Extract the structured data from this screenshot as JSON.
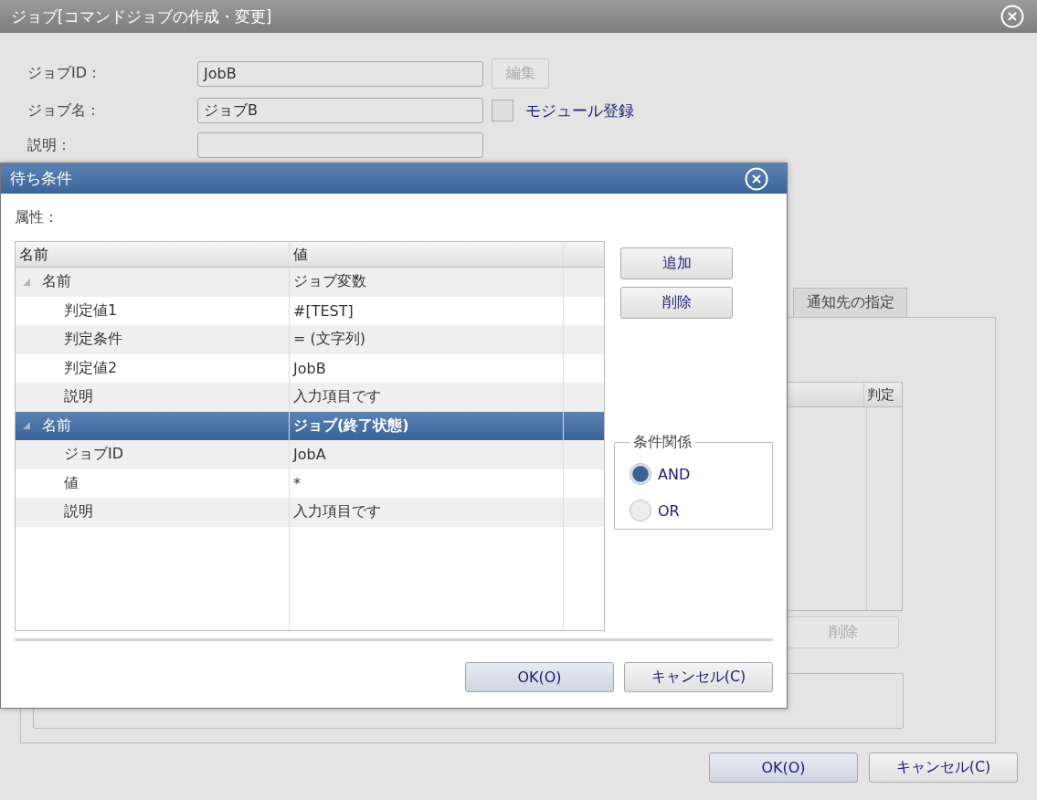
{
  "window": {
    "title": "ジョブ[コマンドジョブの作成・変更]"
  },
  "form": {
    "job_id": {
      "label": "ジョブID：",
      "value": "JobB"
    },
    "edit_button": {
      "label": "編集",
      "disabled": true
    },
    "job_name": {
      "label": "ジョブ名：",
      "value": "ジョブB"
    },
    "module": {
      "label": "モジュール登録",
      "checked": false
    },
    "description": {
      "label": "説明："
    }
  },
  "tabs": [
    {
      "label": "通知先の指定",
      "selected": false
    }
  ],
  "table": {
    "columns": [
      "判定"
    ]
  },
  "delete_button": {
    "label": "削除",
    "disabled": true
  },
  "buttons": [
    "OK(O)",
    "キャンセル(C)"
  ],
  "dialog": {
    "title": "待ち条件",
    "attributes_label": "属性：",
    "columns": [
      "名前",
      "値"
    ],
    "groups": [
      {
        "name": "名前",
        "value": "ジョブ変数",
        "expanded": true,
        "selected": false,
        "children": [
          {
            "name": "判定値1",
            "value": "#[TEST]"
          },
          {
            "name": "判定条件",
            "value": "= (文字列)"
          },
          {
            "name": "判定値2",
            "value": "JobB"
          },
          {
            "name": "説明",
            "value": "入力項目です"
          }
        ]
      },
      {
        "name": "名前",
        "value": "ジョブ(終了状態)",
        "expanded": true,
        "selected": true,
        "children": [
          {
            "name": "ジョブID",
            "value": "JobA"
          },
          {
            "name": "値",
            "value": "*"
          },
          {
            "name": "説明",
            "value": "入力項目です"
          }
        ]
      }
    ],
    "side_buttons": [
      "追加",
      "削除"
    ],
    "relation": {
      "legend": "条件関係",
      "options": [
        {
          "label": "AND",
          "selected": true
        },
        {
          "label": "OR",
          "selected": false
        }
      ]
    },
    "buttons": [
      "OK(O)",
      "キャンセル(C)"
    ]
  }
}
